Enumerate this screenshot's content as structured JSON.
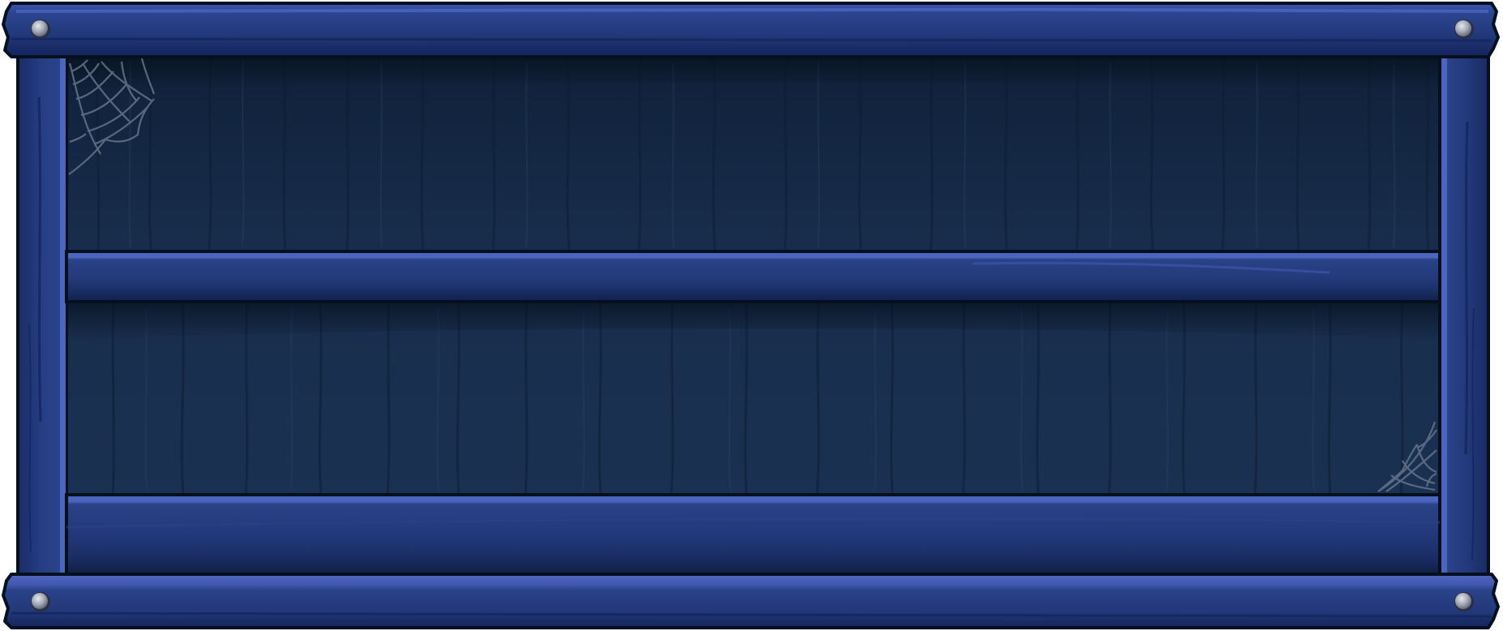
{
  "bookshelf": {
    "compartments": 2,
    "shelf_boards": 2,
    "nails": 4,
    "decorations": [
      "cobweb",
      "cobweb"
    ]
  },
  "colors": {
    "frame_blue": "#22387a",
    "frame_highlight": "#4c65bf",
    "frame_shadow": "#101d45",
    "outline": "#05101e",
    "back_panel": "#172b48",
    "back_panel_dark": "#0d1a2e",
    "nail_light": "#c9cdd6",
    "nail_dark": "#5a6070",
    "cobweb": "#66748a"
  }
}
